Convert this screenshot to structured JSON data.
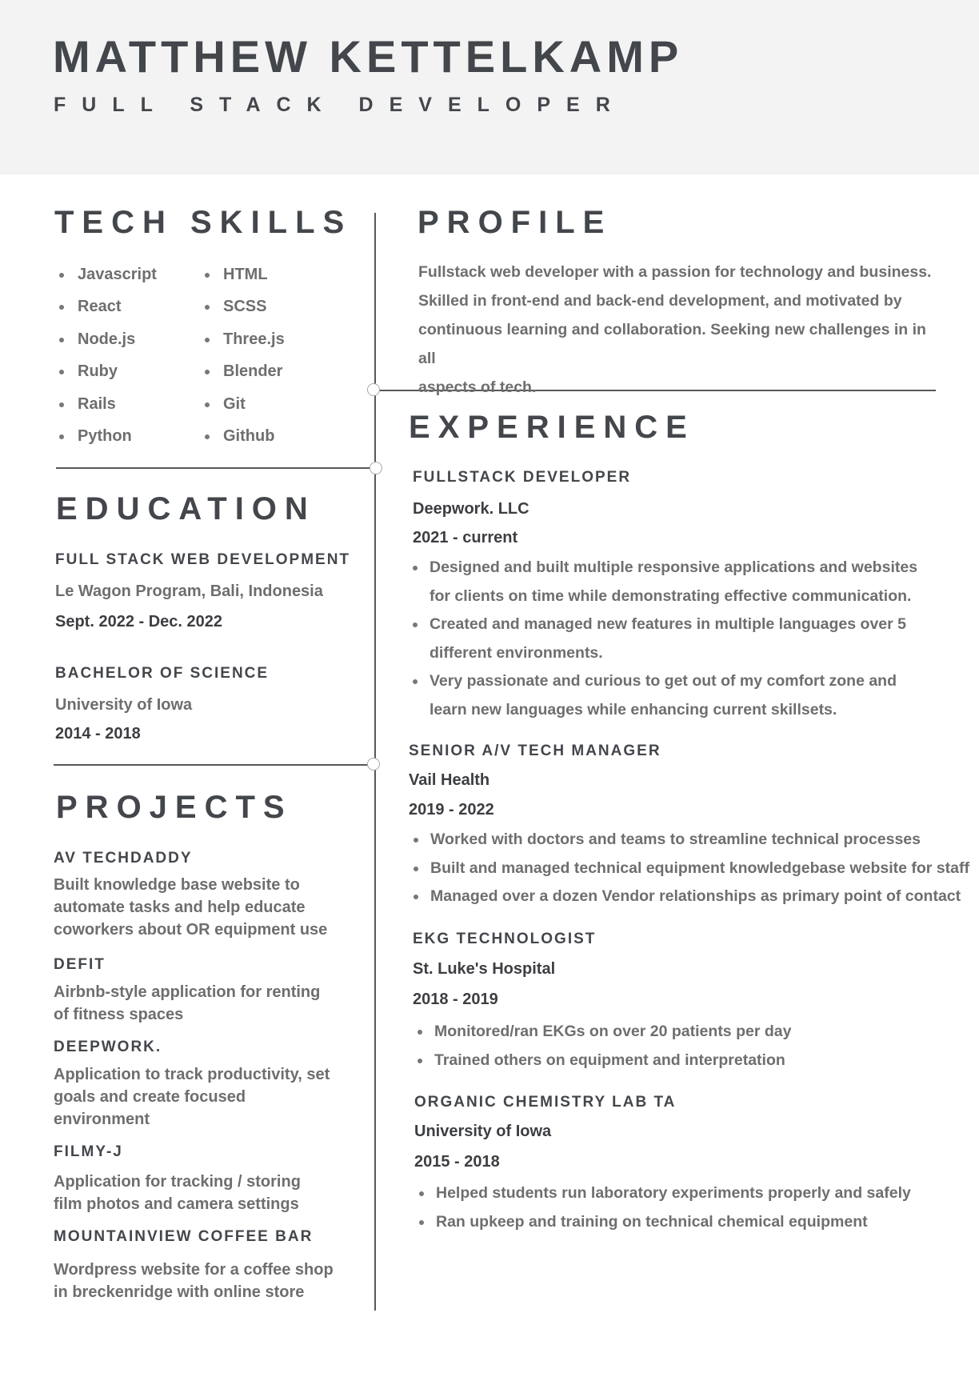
{
  "header": {
    "name": "MATTHEW KETTELKAMP",
    "title": "FULL STACK DEVELOPER"
  },
  "tech_skills": {
    "heading": "TECH SKILLS",
    "col1": [
      "Javascript",
      "React",
      "Node.js",
      "Ruby",
      "Rails",
      "Python"
    ],
    "col2": [
      "HTML",
      "SCSS",
      "Three.js",
      "Blender",
      "Git",
      "Github"
    ]
  },
  "education": {
    "heading": "EDUCATION",
    "items": [
      {
        "degree": "FULL STACK WEB DEVELOPMENT",
        "school": "Le Wagon Program, Bali, Indonesia",
        "dates": "Sept. 2022 -  Dec. 2022"
      },
      {
        "degree": "BACHELOR OF SCIENCE",
        "school": "University of Iowa",
        "dates": "2014 - 2018"
      }
    ]
  },
  "projects": {
    "heading": "PROJECTS",
    "items": [
      {
        "name": "AV TECHDADDY",
        "desc": [
          "Built knowledge base website to",
          "automate tasks and help educate",
          "coworkers about OR equipment use"
        ]
      },
      {
        "name": "DEFIT",
        "desc": [
          "Airbnb-style application for renting",
          "of fitness spaces"
        ]
      },
      {
        "name": "DEEPWORK.",
        "desc": [
          "Application to track productivity, set",
          "goals and create focused",
          "environment"
        ]
      },
      {
        "name": "FILMY-J",
        "desc": [
          "Application for tracking / storing",
          "film photos and camera settings"
        ]
      },
      {
        "name": "MOUNTAINVIEW COFFEE BAR",
        "desc": [
          "Wordpress website for a coffee shop",
          "in breckenridge with online store"
        ]
      }
    ]
  },
  "profile": {
    "heading": "PROFILE",
    "lines": [
      "Fullstack web developer with a passion for technology and business.",
      "Skilled in front-end and back-end development, and motivated by",
      "continuous learning and collaboration. Seeking new challenges in in all",
      "aspects of tech."
    ]
  },
  "experience": {
    "heading": "EXPERIENCE",
    "jobs": [
      {
        "title": "FULLSTACK DEVELOPER",
        "company": "Deepwork. LLC",
        "dates": "2021 - current",
        "bullets": [
          [
            "Designed and built multiple responsive applications and websites",
            "for clients on time while demonstrating effective communication."
          ],
          [
            "Created and managed new features in multiple languages over 5",
            "different environments."
          ],
          [
            "Very passionate and curious to get out of my comfort zone and",
            "learn new languages while enhancing current skillsets."
          ]
        ]
      },
      {
        "title": "SENIOR A/V TECH MANAGER",
        "company": "Vail Health",
        "dates": "2019 - 2022",
        "bullets": [
          [
            "Worked with doctors and teams to streamline technical processes"
          ],
          [
            "Built and managed technical equipment knowledgebase website for staff"
          ],
          [
            "Managed over a dozen Vendor relationships as primary point of contact"
          ]
        ]
      },
      {
        "title": "EKG TECHNOLOGIST",
        "company": "St. Luke's Hospital",
        "dates": "2018 - 2019",
        "bullets": [
          [
            "Monitored/ran EKGs on over 20 patients per day"
          ],
          [
            "Trained others on equipment and interpretation"
          ]
        ]
      },
      {
        "title": "ORGANIC CHEMISTRY LAB TA",
        "company": "University of Iowa",
        "dates": "2015 - 2018",
        "bullets": [
          [
            "Helped students run laboratory experiments properly and safely"
          ],
          [
            "Ran upkeep and training on technical chemical equipment"
          ]
        ]
      }
    ]
  }
}
